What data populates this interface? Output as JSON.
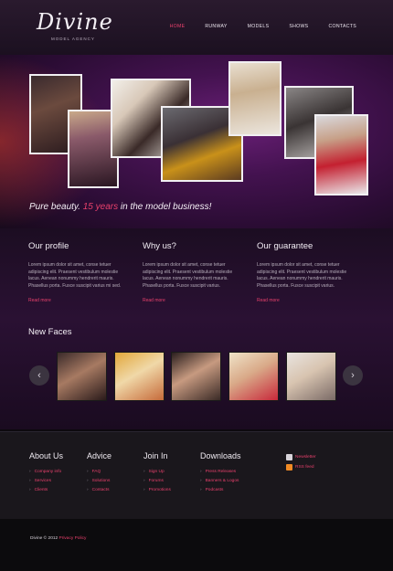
{
  "brand": {
    "name": "Divine",
    "tagline": "MODEL AGENCY"
  },
  "nav": [
    {
      "label": "HOME",
      "active": true
    },
    {
      "label": "RUNWAY",
      "active": false
    },
    {
      "label": "MODELS",
      "active": false
    },
    {
      "label": "SHOWS",
      "active": false
    },
    {
      "label": "CONTACTS",
      "active": false
    }
  ],
  "hero": {
    "tagline_start": "Pure beauty.",
    "tagline_accent": "15 years",
    "tagline_end": "in the model business!"
  },
  "columns": [
    {
      "title": "Our profile",
      "text": "Lorem ipsum dolor sit amet, conse tetuer adipiscing elit. Praesent vestibulum molestie lacus. Aenean nonummy hendrerit mauris. Phasellus porta. Fusce suscipit varius mi sed.",
      "more": "Read more"
    },
    {
      "title": "Why us?",
      "text": "Lorem ipsum dolor sit amet, conse tetuer adipiscing elit. Praesent vestibulum molestie lacus. Aenean nonummy hendrerit mauris. Phasellus porta. Fusce suscipit varius.",
      "more": "Read more"
    },
    {
      "title": "Our guarantee",
      "text": "Lorem ipsum dolor sit amet, conse tetuer adipiscing elit. Praesent vestibulum molestie lacus. Aenean nonummy hendrerit mauris. Phasellus porta. Fusce suscipit varius.",
      "more": "Read more"
    }
  ],
  "new_faces": {
    "title": "New Faces",
    "prev": "‹",
    "next": "›"
  },
  "footer": {
    "columns": [
      {
        "title": "About Us",
        "links": [
          "Company info",
          "Services",
          "Clients"
        ]
      },
      {
        "title": "Advice",
        "links": [
          "FAQ",
          "Solutions",
          "Contacts"
        ]
      },
      {
        "title": "Join In",
        "links": [
          "Sign Up",
          "Forums",
          "Promotions"
        ]
      },
      {
        "title": "Downloads",
        "links": [
          "Press Releases",
          "Banners & Logos",
          "Podcasts"
        ]
      }
    ],
    "social": [
      {
        "label": "Newsletter",
        "icon": "newsletter-icon",
        "color": "#d8d4da"
      },
      {
        "label": "RSS feed",
        "icon": "rss-icon",
        "color": "#f08a24"
      }
    ],
    "copyright": "Divine © 2012",
    "privacy": "Privacy Policy"
  },
  "colors": {
    "accent": "#e8406c",
    "purple": "#5b1a69"
  }
}
